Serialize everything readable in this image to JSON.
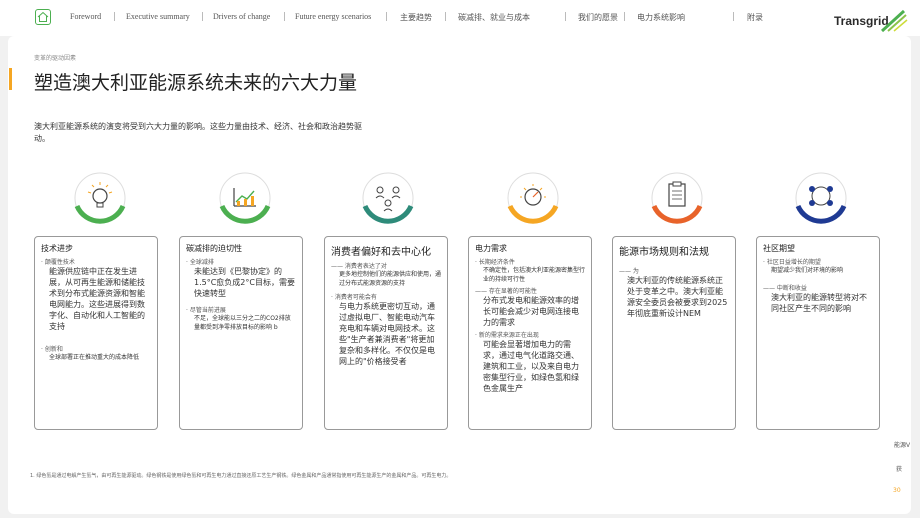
{
  "nav": {
    "items": [
      "Foreword",
      "Executive summary",
      "Drivers of change",
      "Future energy scenarios",
      "主要趋势",
      "碳减排、就业与成本",
      "我们的愿景",
      "电力系统影响",
      "附录"
    ],
    "logo": "Transgrid"
  },
  "page": {
    "breadcrumb": "变革的驱动因素",
    "title": "塑造澳大利亚能源系统未来的六大力量",
    "intro": "澳大利亚能源系统的演变将受到六大力量的影响。这些力量由技术、经济、社会和政治趋势驱动。"
  },
  "colors": {
    "green": "#4caf50",
    "teal": "#2e8b7a",
    "orange": "#f5a623",
    "orange2": "#e8632a",
    "navy": "#1f3a93"
  },
  "panels": [
    {
      "h": "技术进步",
      "lines": [
        {
          "s": "· 颠覆性技术",
          "b": "能源供应链中正在发生进展，从可再生能源和储能技术到分布式能源资源和智能电网能力。这些进展得到数字化、自动化和人工智能的支持"
        },
        {
          "s": "· 创新和",
          "b": "全球部署正在推动重大的成本降低"
        }
      ]
    },
    {
      "h": "碳减排的迫切性",
      "lines": [
        {
          "s": "· 全球减排",
          "b": "未能达到《巴黎协定》的1.5°C愈负成2°C目标，需要快速转型"
        },
        {
          "s": "· 尽管当前进展",
          "b": "不足，全球能以三分之二的CO2排放量都受到净零排放目标的影响 b"
        }
      ]
    },
    {
      "h": "消费者偏好和去中心化",
      "lines": [
        {
          "s": "—— 消费者表达了对",
          "b": "更多地控制他们的能源供应和使用，通过分布式能源资源的支持"
        },
        {
          "s": "· 消费者可能会有",
          "b": "与电力系统更密切互动，通过虚拟电厂、智能电动汽车充电和车辆对电网技术。这些\"生产者兼消费者\"将更加复杂和多样化。不仅仅是电网上的\"价格接受者"
        }
      ]
    },
    {
      "h": "电力需求",
      "lines": [
        {
          "s": "· 长期经济条件",
          "b": "不确定性，包括澳大利亚能源密集型行业的持续可行性"
        },
        {
          "s": "—— 存在显著的可能性",
          "b": "分布式发电和能源效率的增长可能会减少对电网连接电力的需求"
        },
        {
          "s": "· 新的需求来源正在出现",
          "b": "可能会显著增加电力的需求，通过电气化道路交通、建筑和工业，以及来自电力密集型行业，如绿色氢和绿色金属生产"
        }
      ]
    },
    {
      "h": "能源市场规则和法规",
      "lines": [
        {
          "s": "—— 为",
          "b": "澳大利亚的传统能源系统正处于变革之中。澳大利亚能源安全委员会被要求到2025年彻底重新设计NEM"
        }
      ]
    },
    {
      "h": "社区期望",
      "lines": [
        {
          "s": "· 社区日益增长的期望",
          "b": "期望减少我们对环境的影响"
        },
        {
          "s": "—— 中断和收益",
          "b": "澳大利亚的能源转型将对不同社区产生不同的影响"
        }
      ]
    }
  ],
  "footnote": "1. 绿色氢是通过电解产生氢气，由可再生能源驱动。绿色钢铁是使用绿色氢和可再生电力通过直接还原工艺生产钢铁。绿色金属和产品通常指使用可再生能源生产的金属和产品。可再生电力。",
  "side": {
    "label": "能源V",
    "b": "获",
    "page": "30"
  }
}
